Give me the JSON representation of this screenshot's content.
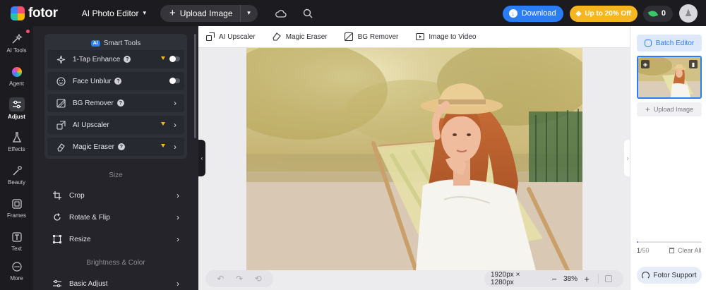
{
  "topbar": {
    "logo_text": "fotor",
    "product_menu": "AI Photo Editor",
    "upload_label": "Upload Image",
    "download_label": "Download",
    "promo_label": "Up to 20% Off",
    "credits": "0",
    "accent": "#2b7df5",
    "promo_color": "#f5b620"
  },
  "rail": {
    "items": [
      {
        "label": "AI Tools",
        "icon": "sparkle-wand-icon"
      },
      {
        "label": "Agent",
        "icon": "agent-color-orb-icon"
      },
      {
        "label": "Adjust",
        "icon": "sliders-icon",
        "active": true
      },
      {
        "label": "Effects",
        "icon": "flask-icon"
      },
      {
        "label": "Beauty",
        "icon": "beauty-wand-icon"
      },
      {
        "label": "Frames",
        "icon": "frame-icon"
      },
      {
        "label": "Text",
        "icon": "text-t-icon"
      },
      {
        "label": "More",
        "icon": "more-dots-icon"
      }
    ]
  },
  "panel": {
    "smart_tools": {
      "badge": "AI",
      "title": "Smart Tools",
      "tools": [
        {
          "label": "1-Tap Enhance",
          "control": "toggle",
          "on": false
        },
        {
          "label": "Face Unblur",
          "control": "toggle",
          "on": false
        },
        {
          "label": "BG Remover",
          "control": "chevron"
        },
        {
          "label": "AI Upscaler",
          "control": "chevron"
        },
        {
          "label": "Magic Eraser",
          "control": "chevron"
        }
      ]
    },
    "size_section": {
      "title": "Size",
      "items": [
        "Crop",
        "Rotate & Flip",
        "Resize"
      ]
    },
    "color_section": {
      "title": "Brightness & Color",
      "items": [
        "Basic Adjust"
      ]
    }
  },
  "toolstrip": {
    "items": [
      "AI Upscaler",
      "Magic Eraser",
      "BG Remover",
      "Image to Video"
    ]
  },
  "canvas": {
    "dimensions": "1920px × 1280px",
    "zoom": "38%"
  },
  "rpanel": {
    "batch_label": "Batch Editor",
    "upload_label": "Upload Image",
    "count_current": "1",
    "count_total": "/50",
    "progress_fraction": 0.02,
    "clear_label": "Clear All",
    "support_label": "Fotor Support"
  }
}
